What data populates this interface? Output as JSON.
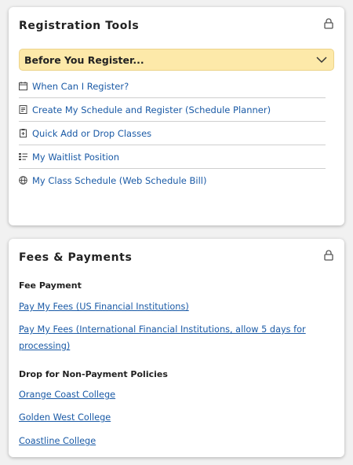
{
  "registration": {
    "title": "Registration Tools",
    "accordion_label": "Before You Register...",
    "items": [
      {
        "label": "When Can I Register?",
        "icon": "calendar-icon"
      },
      {
        "label": "Create My Schedule and Register (Schedule Planner)",
        "icon": "schedule-icon"
      },
      {
        "label": "Quick Add or Drop Classes",
        "icon": "clipboard-icon"
      },
      {
        "label": "My Waitlist Position",
        "icon": "list-icon"
      },
      {
        "label": "My Class Schedule (Web Schedule Bill)",
        "icon": "globe-icon"
      }
    ]
  },
  "fees": {
    "title": "Fees & Payments",
    "fee_payment_heading": "Fee Payment",
    "fee_links": [
      "Pay My Fees (US Financial Institutions)",
      "Pay My Fees (International Financial Institutions, allow 5 days for processing)"
    ],
    "policies_heading": "Drop for Non-Payment Policies",
    "policy_links": [
      "Orange Coast College",
      "Golden West College",
      "Coastline College"
    ]
  },
  "colors": {
    "link": "#1a5aa6",
    "accordion_bg": "#fde9a9",
    "page_bg": "#f1f1f1"
  }
}
